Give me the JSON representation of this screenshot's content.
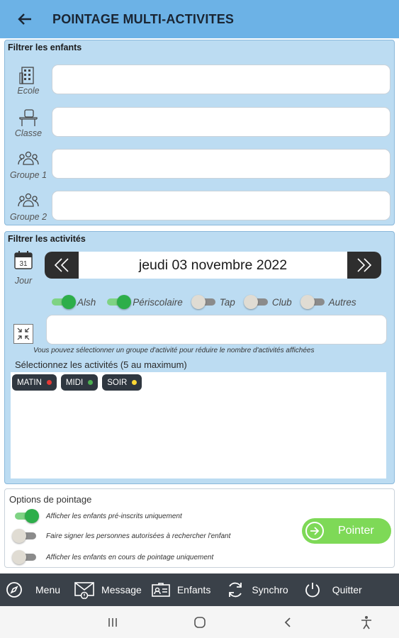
{
  "appbar": {
    "title": "POINTAGE MULTI-ACTIVITES",
    "back_icon": "arrow-left-icon"
  },
  "filter_children": {
    "title": "Filtrer les enfants",
    "rows": [
      {
        "label": "Ecole",
        "icon": "building-icon",
        "value": ""
      },
      {
        "label": "Classe",
        "icon": "desk-icon",
        "value": ""
      },
      {
        "label": "Groupe 1",
        "icon": "group-icon",
        "value": ""
      },
      {
        "label": "Groupe 2",
        "icon": "group-icon",
        "value": ""
      }
    ]
  },
  "filter_activities": {
    "title": "Filtrer les activités",
    "day": {
      "label": "Jour",
      "calendar_number": "31",
      "date": "jeudi 03 novembre 2022"
    },
    "toggles": [
      {
        "label": "Alsh",
        "on": true
      },
      {
        "label": "Périscolaire",
        "on": true
      },
      {
        "label": "Tap",
        "on": false
      },
      {
        "label": "Club",
        "on": false
      },
      {
        "label": "Autres",
        "on": false
      }
    ],
    "group_value": "",
    "hint": "Vous pouvez sélectionner un groupe d'activité pour réduire le nombre d'activités affichées",
    "select_label": "Sélectionnez les activités (5 au maximum)",
    "chips": [
      {
        "label": "MATIN",
        "color": "#e53935"
      },
      {
        "label": "MIDI",
        "color": "#4caf50"
      },
      {
        "label": "SOIR",
        "color": "#fdd835"
      }
    ]
  },
  "options": {
    "title": "Options de pointage",
    "items": [
      {
        "label": "Afficher les enfants pré-inscrits uniquement",
        "on": true
      },
      {
        "label": "Faire signer les personnes autorisées à rechercher l'enfant",
        "on": false
      },
      {
        "label": "Afficher les enfants en cours de pointage uniquement",
        "on": false
      }
    ],
    "pointer_label": "Pointer"
  },
  "bottombar": {
    "menu": "Menu",
    "message": "Message",
    "enfants": "Enfants",
    "synchro": "Synchro",
    "quitter": "Quitter"
  },
  "colors": {
    "appbar": "#6cb2e6",
    "panel": "#bcdcf2",
    "toggle_on": "#2dae4a",
    "pointer": "#7ed957",
    "bottombar": "#3a4149"
  }
}
